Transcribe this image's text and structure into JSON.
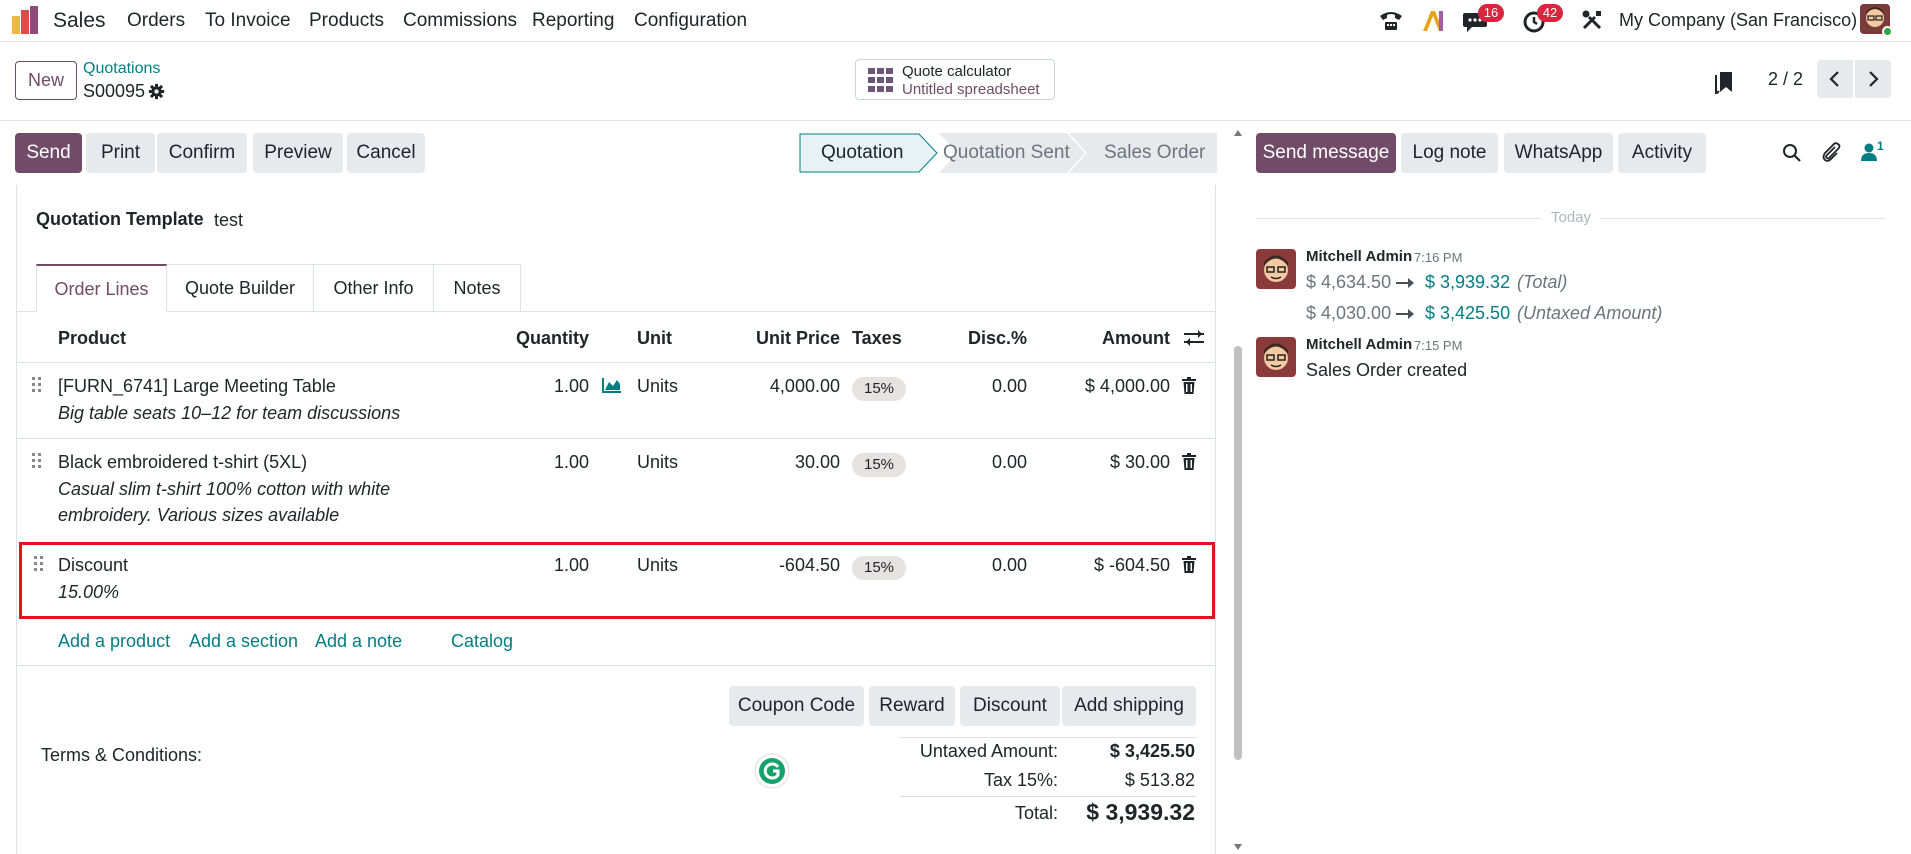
{
  "topnav": {
    "app_name": "Sales",
    "menu": [
      "Orders",
      "To Invoice",
      "Products",
      "Commissions",
      "Reporting",
      "Configuration"
    ],
    "messages_badge": "16",
    "activities_badge": "42",
    "company": "My Company (San Francisco)"
  },
  "control": {
    "new_label": "New",
    "breadcrumb_parent": "Quotations",
    "record_name": "S00095",
    "calculator_title": "Quote calculator",
    "calculator_subtitle": "Untitled spreadsheet",
    "pager": "2 / 2"
  },
  "actions": {
    "send": "Send",
    "print": "Print",
    "confirm": "Confirm",
    "preview": "Preview",
    "cancel": "Cancel"
  },
  "stages": [
    "Quotation",
    "Quotation Sent",
    "Sales Order"
  ],
  "form": {
    "template_label": "Quotation Template",
    "template_value": "test",
    "tabs": [
      "Order Lines",
      "Quote Builder",
      "Other Info",
      "Notes"
    ],
    "columns": {
      "product": "Product",
      "quantity": "Quantity",
      "unit": "Unit",
      "unit_price": "Unit Price",
      "taxes": "Taxes",
      "disc": "Disc.%",
      "amount": "Amount"
    },
    "lines": [
      {
        "product": "[FURN_6741] Large Meeting Table",
        "desc1": "Big table seats 10–12 for team discussions",
        "desc2": "",
        "quantity": "1.00",
        "unit": "Units",
        "unit_price": "4,000.00",
        "tax": "15%",
        "disc": "0.00",
        "amount": "$ 4,000.00"
      },
      {
        "product": "Black embroidered t-shirt (5XL)",
        "desc1": "Casual slim t-shirt 100% cotton with white",
        "desc2": "embroidery. Various sizes available",
        "quantity": "1.00",
        "unit": "Units",
        "unit_price": "30.00",
        "tax": "15%",
        "disc": "0.00",
        "amount": "$ 30.00"
      },
      {
        "product": "Discount",
        "desc1": "15.00%",
        "desc2": "",
        "quantity": "1.00",
        "unit": "Units",
        "unit_price": "-604.50",
        "tax": "15%",
        "disc": "0.00",
        "amount": "$ -604.50"
      }
    ],
    "add_links": {
      "add_product": "Add a product",
      "add_section": "Add a section",
      "add_note": "Add a note",
      "catalog": "Catalog"
    },
    "extra_buttons": {
      "coupon": "Coupon Code",
      "reward": "Reward",
      "discount": "Discount",
      "shipping": "Add shipping"
    },
    "terms_label": "Terms & Conditions:",
    "totals": {
      "untaxed_label": "Untaxed Amount:",
      "untaxed_value": "$ 3,425.50",
      "tax_label": "Tax 15%:",
      "tax_value": "$ 513.82",
      "total_label": "Total:",
      "total_value": "$ 3,939.32"
    }
  },
  "chatter": {
    "send_message": "Send message",
    "log_note": "Log note",
    "whatsapp": "WhatsApp",
    "activity": "Activity",
    "followers_count": "1",
    "date_separator": "Today",
    "messages": [
      {
        "author": "Mitchell Admin",
        "time": "7:16 PM",
        "changes": [
          {
            "old": "$ 4,634.50",
            "new": "$ 3,939.32",
            "field": "(Total)"
          },
          {
            "old": "$ 4,030.00",
            "new": "$ 3,425.50",
            "field": "(Untaxed Amount)"
          }
        ]
      },
      {
        "author": "Mitchell Admin",
        "time": "7:15 PM",
        "body": "Sales Order created"
      }
    ]
  },
  "colors": {
    "primary": "#714b67",
    "teal": "#017e84",
    "highlight_border": "#e0141e",
    "badge_red": "#d7263d"
  }
}
